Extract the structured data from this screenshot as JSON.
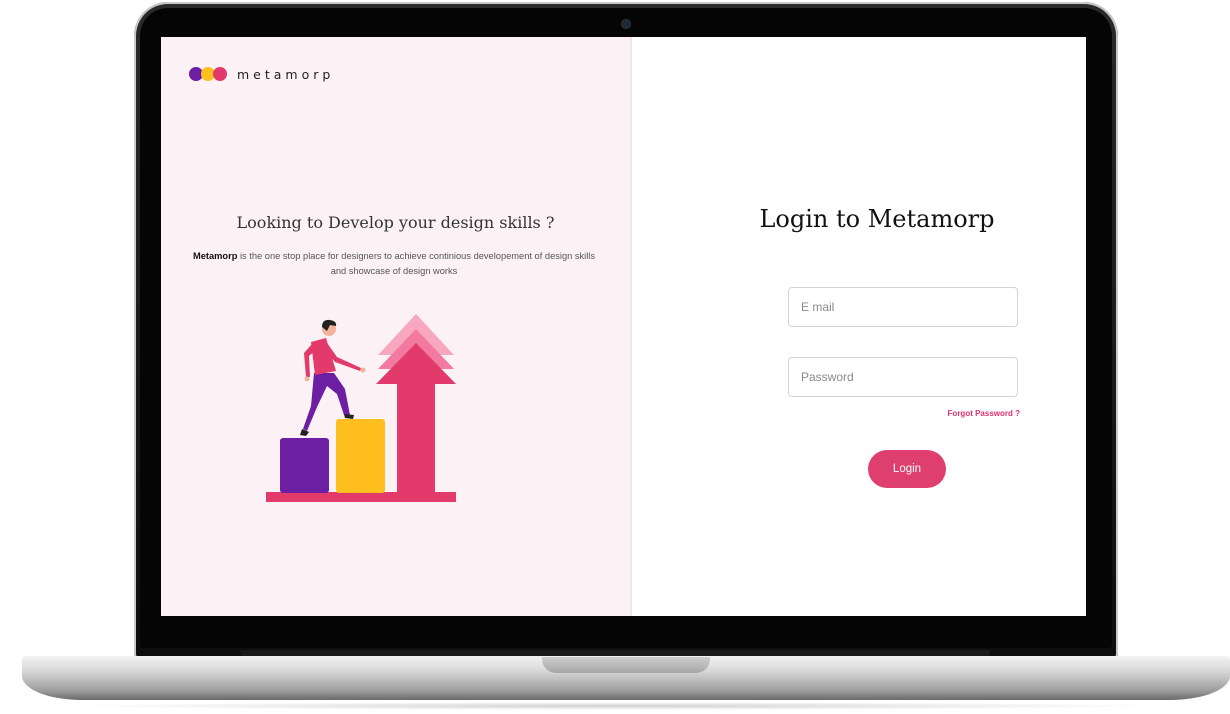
{
  "logo": {
    "brand": "metamorp",
    "dot_colors": [
      "#6c1fa3",
      "#ffbf1f",
      "#e23a6a"
    ]
  },
  "hero": {
    "title": "Looking to Develop your design skills ?",
    "desc_bold": "Metamorp",
    "desc_rest": " is the one stop place for designers to achieve continious developement of design skills and showcase of design works"
  },
  "login": {
    "title": "Login to Metamorp",
    "email_placeholder": "E mail",
    "password_placeholder": "Password",
    "forgot_label": "Forgot Password ?",
    "submit_label": "Login"
  },
  "colors": {
    "accent": "#df3f6e",
    "left_bg": "#fcf2f5",
    "purple": "#6c1fa3",
    "yellow": "#ffbf1f"
  }
}
